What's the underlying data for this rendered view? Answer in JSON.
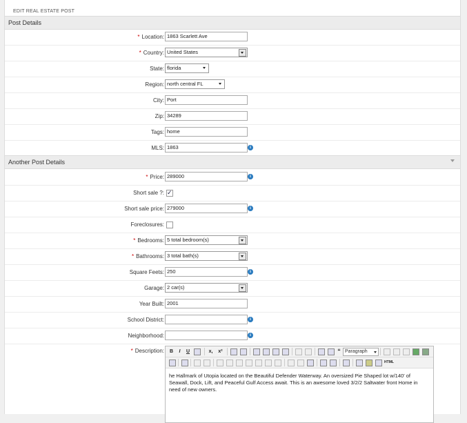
{
  "page": {
    "title": "EDIT REAL ESTATE POST"
  },
  "sections": {
    "post_details": "Post Details",
    "another_post_details": "Another Post Details"
  },
  "fields": {
    "location": {
      "label": "Location:",
      "value": "1863 Scarlett Ave"
    },
    "country": {
      "label": "Country:",
      "value": "United States"
    },
    "state": {
      "label": "State:",
      "value": "florida"
    },
    "region": {
      "label": "Region:",
      "value": "north central FL"
    },
    "city": {
      "label": "City:",
      "value": "Port"
    },
    "zip": {
      "label": "Zip:",
      "value": "34289"
    },
    "tags": {
      "label": "Tags:",
      "value": "home"
    },
    "mls": {
      "label": "MLS:",
      "value": "1863"
    },
    "price": {
      "label": "Price:",
      "value": "289000"
    },
    "short_sale": {
      "label": "Short sale ?:",
      "checked": true
    },
    "short_sale_price": {
      "label": "Short sale price:",
      "value": "279000"
    },
    "foreclosures": {
      "label": "Foreclosures:",
      "checked": false
    },
    "bedrooms": {
      "label": "Bedrooms:",
      "value": "5 total bedroom(s)"
    },
    "bathrooms": {
      "label": "Bathrooms:",
      "value": "3 total bath(s)"
    },
    "square_feets": {
      "label": "Square Feets:",
      "value": "250"
    },
    "garage": {
      "label": "Garage:",
      "value": "2 car(s)"
    },
    "year_built": {
      "label": "Year Built:",
      "value": "2001"
    },
    "school_district": {
      "label": "School District:",
      "value": ""
    },
    "neighborhood": {
      "label": "Neighborhood:",
      "value": ""
    },
    "description": {
      "label": "Description:",
      "format": "Paragraph",
      "text": "he Hallmark of Utopia located on the Beautiful Defender Waterway. An oversized Pie Shaped lot w/140' of Seawall, Dock, Lift, and Peaceful Gulf Access await. This is an awesome loved 3/2/2 Saltwater front Home in need of new owners."
    }
  },
  "toolbar": {
    "bold": "B",
    "italic": "I",
    "underline": "U",
    "subscript": "x,",
    "superscript": "x²",
    "quote": "“",
    "html": "HTML"
  },
  "required_mark": "*",
  "info_icon_glyph": "i",
  "colors": {
    "required": "#cc0000",
    "info": "#2a7bbf",
    "section_bg": "#ececec"
  }
}
